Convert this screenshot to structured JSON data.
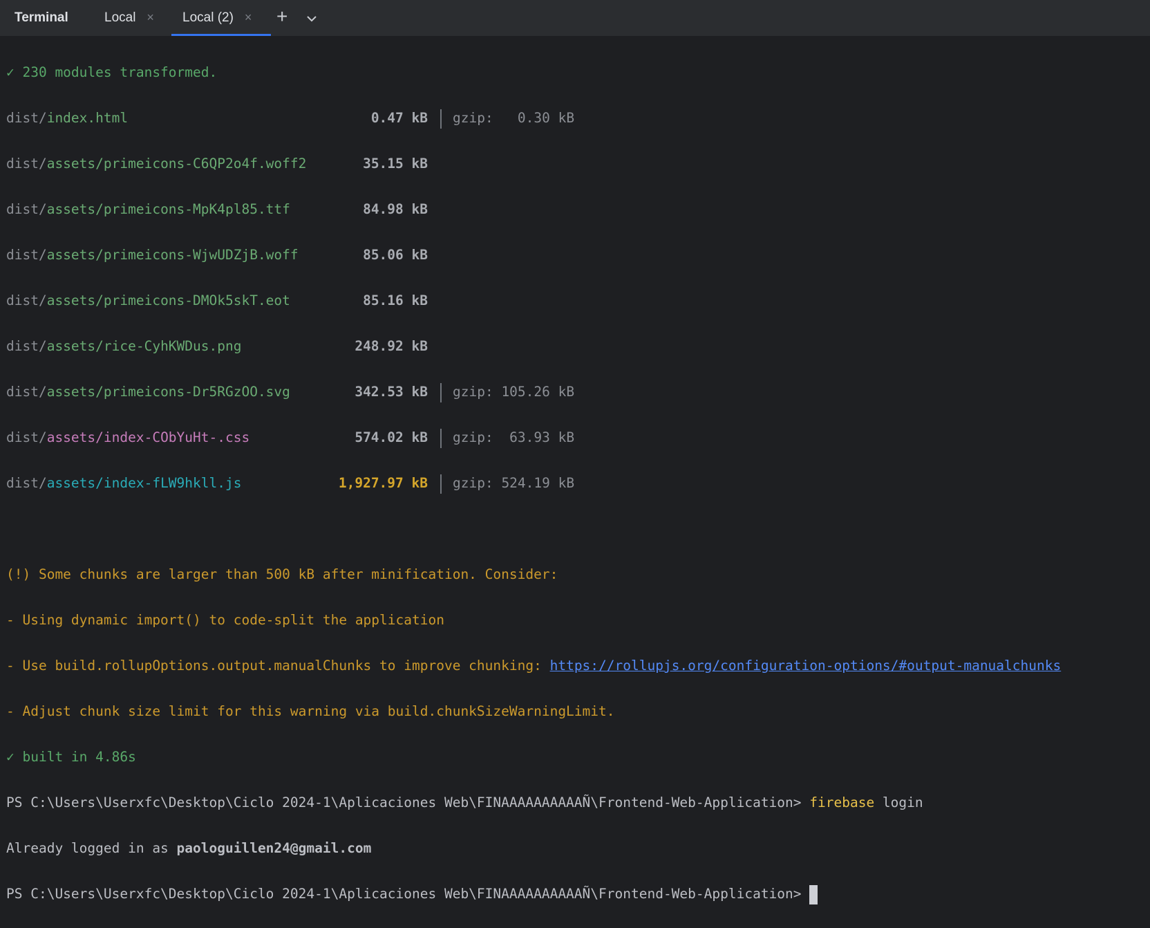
{
  "tabs": {
    "title": "Terminal",
    "items": [
      {
        "label": "Local",
        "close": "×"
      },
      {
        "label": "Local (2)",
        "close": "×"
      }
    ],
    "plus": "+",
    "chevron": "chevron-down-icon"
  },
  "output": {
    "modules": "✓ 230 modules transformed.",
    "files": [
      {
        "prefix": "dist/",
        "name": "index.html",
        "size": "0.47 kB",
        "gzip": "gzip:   0.30 kB"
      },
      {
        "prefix": "dist/",
        "name": "assets/primeicons-C6QP2o4f.woff2",
        "size": "35.15 kB",
        "gzip": ""
      },
      {
        "prefix": "dist/",
        "name": "assets/primeicons-MpK4pl85.ttf",
        "size": "84.98 kB",
        "gzip": ""
      },
      {
        "prefix": "dist/",
        "name": "assets/primeicons-WjwUDZjB.woff",
        "size": "85.06 kB",
        "gzip": ""
      },
      {
        "prefix": "dist/",
        "name": "assets/primeicons-DMOk5skT.eot",
        "size": "85.16 kB",
        "gzip": ""
      },
      {
        "prefix": "dist/",
        "name": "assets/rice-CyhKWDus.png",
        "size": "248.92 kB",
        "gzip": ""
      },
      {
        "prefix": "dist/",
        "name": "assets/primeicons-Dr5RGzOO.svg",
        "size": "342.53 kB",
        "gzip": "gzip: 105.26 kB"
      },
      {
        "prefix": "dist/",
        "name": "assets/index-CObYuHt-.css",
        "size": "574.02 kB",
        "gzip": "gzip:  63.93 kB"
      },
      {
        "prefix": "dist/",
        "name": "assets/index-fLW9hkll.js",
        "size": "1,927.97 kB",
        "gzip": "gzip: 524.19 kB"
      }
    ],
    "warning": "(!) Some chunks are larger than 500 kB after minification. Consider:",
    "tip1": "- Using dynamic import() to code-split the application",
    "tip2": "- Use build.rollupOptions.output.manualChunks to improve chunking: ",
    "tip2_link": "https://rollupjs.org/configuration-options/#output-manualchunks",
    "tip3": "- Adjust chunk size limit for this warning via build.chunkSizeWarningLimit.",
    "built": "✓ built in 4.86s",
    "prompt": "PS C:\\Users\\Userxfc\\Desktop\\Ciclo 2024-1\\Aplicaciones Web\\FINAAAAAAAAAAÑ\\Frontend-Web-Application> ",
    "cmd1": "firebase",
    "cmd1_arg": " login",
    "logged_in": "Already logged in as ",
    "email": "paologuillen24@gmail.com"
  },
  "colors": {
    "accent": "#3574f0",
    "success": "#59a869",
    "warning": "#cc9a2c",
    "link": "#548af7"
  }
}
